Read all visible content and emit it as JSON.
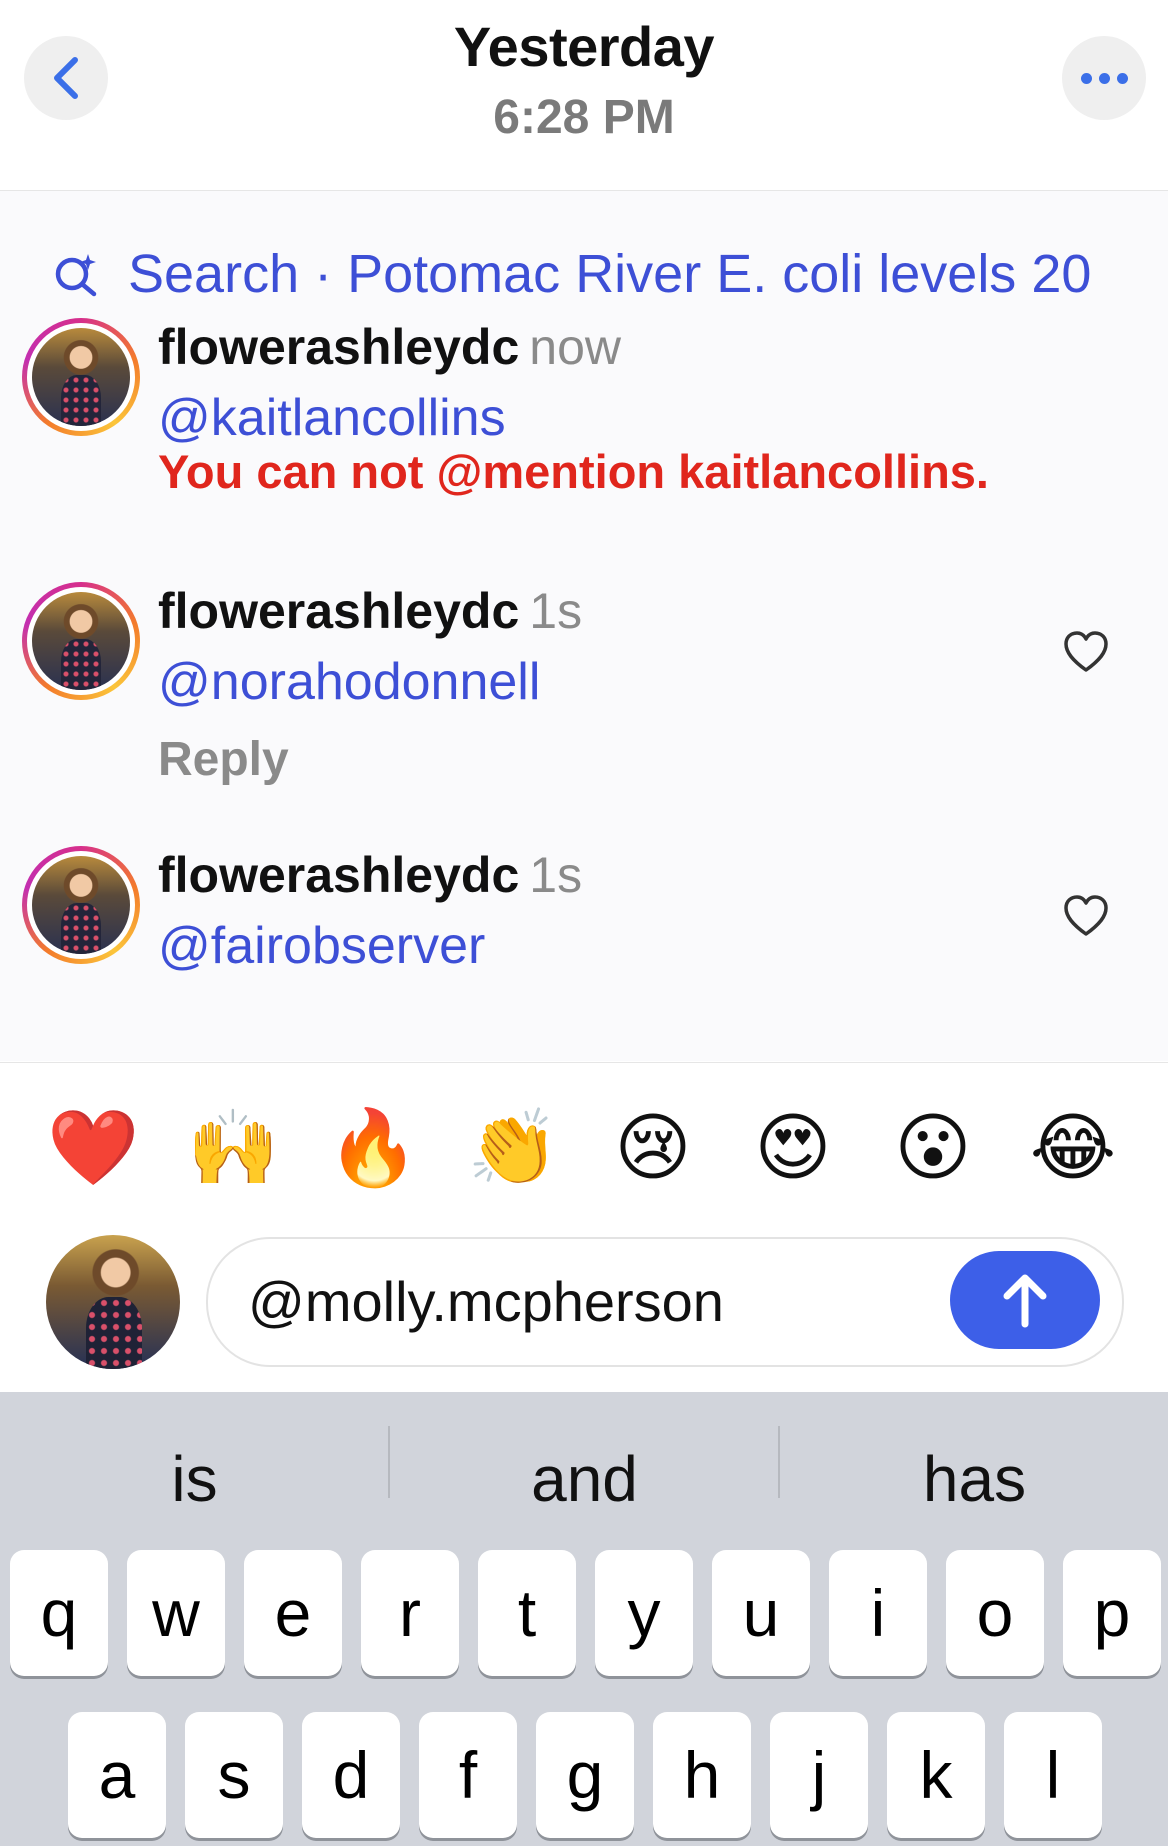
{
  "header": {
    "title": "Yesterday",
    "time": "6:28 PM"
  },
  "search": {
    "text": "Search · Potomac River E. coli levels 20"
  },
  "comments": [
    {
      "username": "flowerashleydc",
      "timestamp": "now",
      "mention": "@kaitlancollins",
      "error": "You can not @mention kaitlancollins."
    },
    {
      "username": "flowerashleydc",
      "timestamp": "1s",
      "mention": "@norahodonnell",
      "reply_label": "Reply"
    },
    {
      "username": "flowerashleydc",
      "timestamp": "1s",
      "mention": "@fairobserver"
    }
  ],
  "reactions": [
    "❤️",
    "🙌",
    "🔥",
    "👏",
    "😢",
    "😍",
    "😮",
    "😂"
  ],
  "composer": {
    "value": "@molly.mcpherson"
  },
  "keyboard": {
    "suggestions": [
      "is",
      "and",
      "has"
    ],
    "row1": [
      "q",
      "w",
      "e",
      "r",
      "t",
      "y",
      "u",
      "i",
      "o",
      "p"
    ],
    "row2": [
      "a",
      "s",
      "d",
      "f",
      "g",
      "h",
      "j",
      "k",
      "l"
    ]
  },
  "colors": {
    "accent": "#3d4fd6",
    "error": "#e0261d",
    "send": "#3d5fe8"
  }
}
